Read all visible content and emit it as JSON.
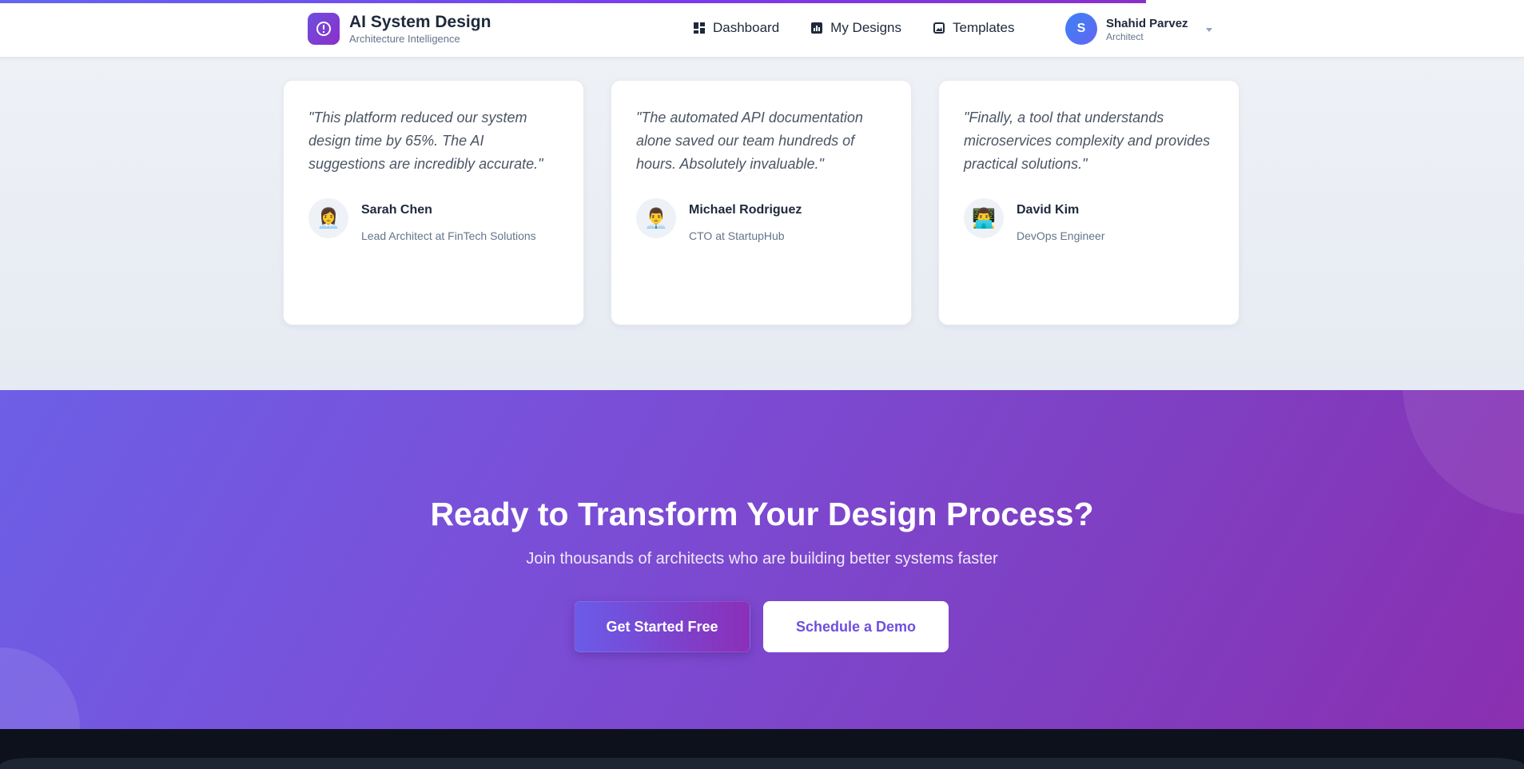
{
  "header": {
    "brand_title": "AI System Design",
    "brand_subtitle": "Architecture Intelligence",
    "nav": [
      {
        "label": "Dashboard",
        "icon": "dashboard-icon"
      },
      {
        "label": "My Designs",
        "icon": "chart-icon"
      },
      {
        "label": "Templates",
        "icon": "image-icon"
      }
    ],
    "user": {
      "initial": "S",
      "name": "Shahid Parvez",
      "role": "Architect"
    }
  },
  "testimonials": [
    {
      "quote": "\"This platform reduced our system design time by 65%. The AI suggestions are incredibly accurate.\"",
      "avatar": "👩‍💼",
      "name": "Sarah Chen",
      "role": "Lead Architect at FinTech Solutions"
    },
    {
      "quote": "\"The automated API documentation alone saved our team hundreds of hours. Absolutely invaluable.\"",
      "avatar": "👨‍💼",
      "name": "Michael Rodriguez",
      "role": "CTO at StartupHub"
    },
    {
      "quote": "\"Finally, a tool that understands microservices complexity and provides practical solutions.\"",
      "avatar": "👨‍💻",
      "name": "David Kim",
      "role": "DevOps Engineer"
    }
  ],
  "cta": {
    "title": "Ready to Transform Your Design Process?",
    "subtitle": "Join thousands of architects who are building better systems faster",
    "primary_button": "Get Started Free",
    "secondary_button": "Schedule a Demo"
  },
  "colors": {
    "accent": "#6d4fe0",
    "accent_end": "#8b2fc9",
    "text_dark": "#1e293b",
    "text_muted": "#64748b"
  }
}
